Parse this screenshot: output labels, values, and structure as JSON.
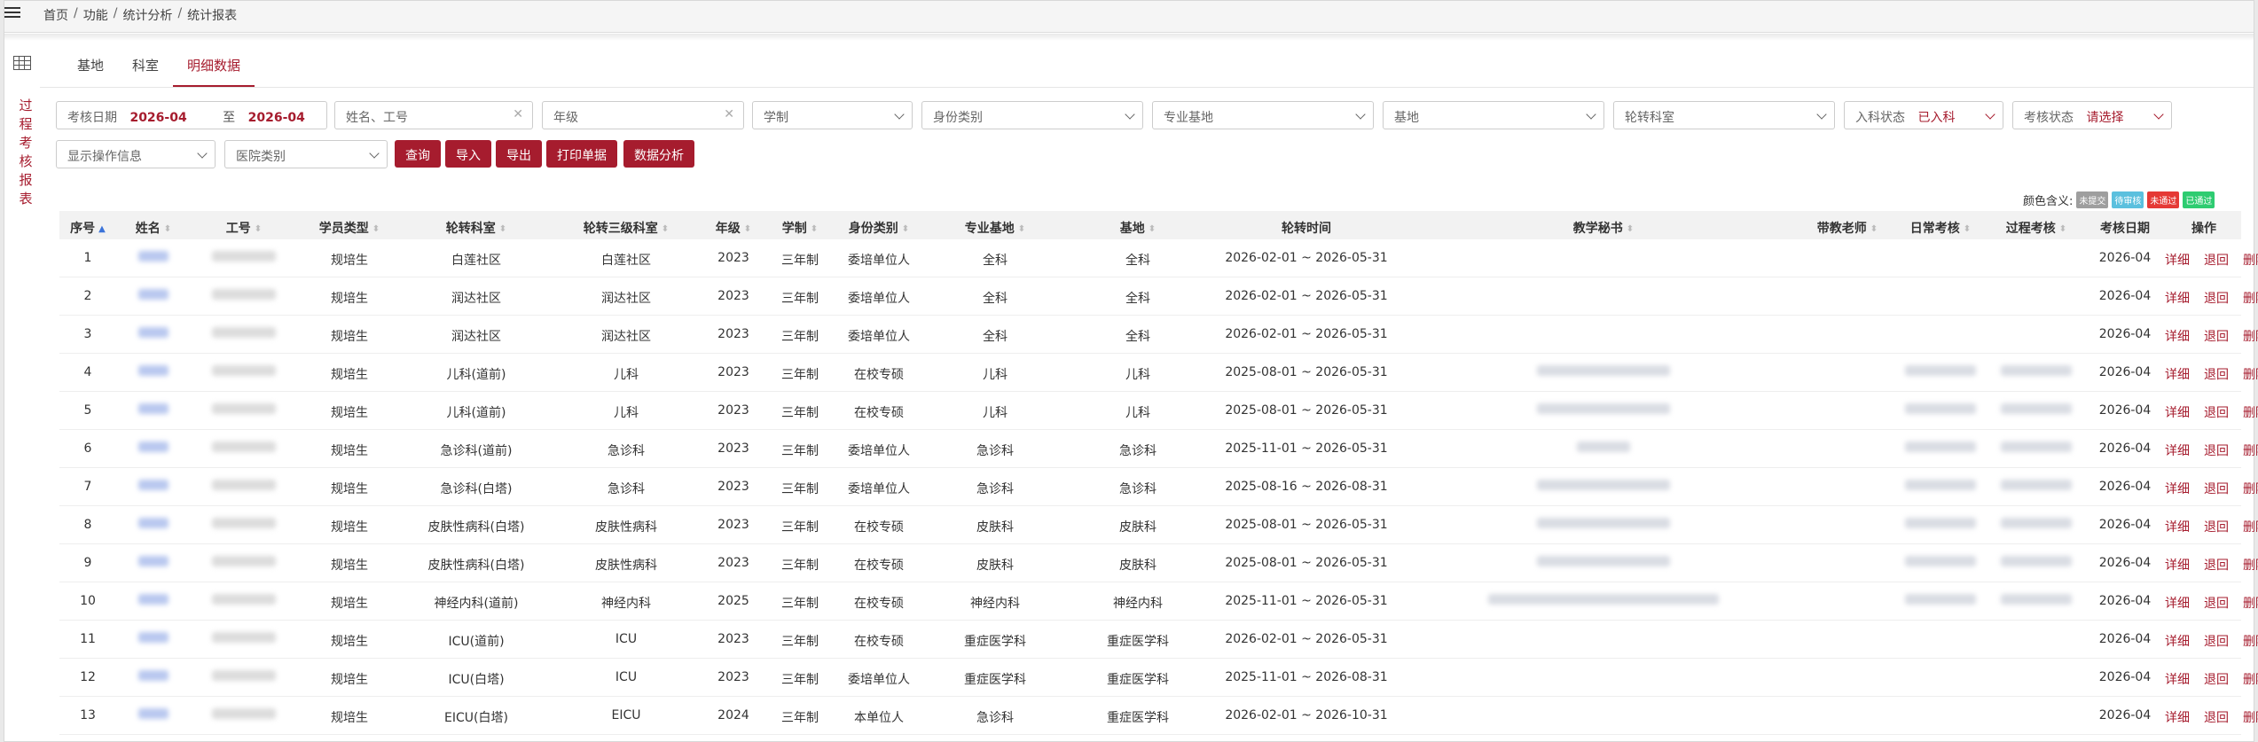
{
  "breadcrumb": [
    "首页",
    "功能",
    "统计分析",
    "统计报表"
  ],
  "side_menu_label": "过程考核报表",
  "tabs": [
    {
      "label": "基地",
      "active": false
    },
    {
      "label": "科室",
      "active": false
    },
    {
      "label": "明细数据",
      "active": true
    }
  ],
  "filters": {
    "date_label": "考核日期",
    "date_from": "2026-04",
    "date_to_sep": "至",
    "date_to": "2026-04",
    "name_placeholder": "姓名、工号",
    "grade_placeholder": "年级",
    "system_placeholder": "学制",
    "identity_placeholder": "身份类别",
    "specialty_placeholder": "专业基地",
    "base_placeholder": "基地",
    "rotation_dept_placeholder": "轮转科室",
    "enroll_label": "入科状态",
    "enroll_value": "已入科",
    "assess_label": "考核状态",
    "assess_value": "请选择",
    "show_ops_placeholder": "显示操作信息",
    "hospital_type_placeholder": "医院类别"
  },
  "buttons": {
    "query": "查询",
    "import": "导入",
    "export": "导出",
    "print": "打印单据",
    "analysis": "数据分析"
  },
  "legend": {
    "label": "颜色含义:",
    "items": [
      {
        "text": "未提交",
        "color": "#9e9e9e"
      },
      {
        "text": "待审核",
        "color": "#5bc0de"
      },
      {
        "text": "未通过",
        "color": "#e53935"
      },
      {
        "text": "已通过",
        "color": "#2ecc71"
      }
    ]
  },
  "columns": [
    "序号",
    "姓名",
    "工号",
    "学员类型",
    "轮转科室",
    "轮转三级科室",
    "年级",
    "学制",
    "身份类别",
    "专业基地",
    "基地",
    "轮转时间",
    "教学秘书",
    "带教老师",
    "日常考核",
    "过程考核",
    "考核日期",
    "操作"
  ],
  "actions": [
    "详细",
    "退回",
    "删除"
  ],
  "rows": [
    {
      "no": "1",
      "type": "规培生",
      "dept": "白莲社区",
      "dept3": "白莲社区",
      "grade": "2023",
      "system": "三年制",
      "identity": "委培单位人",
      "specialty": "全科",
      "base": "全科",
      "period": "2026-02-01 ~ 2026-05-31",
      "date": "2026-04"
    },
    {
      "no": "2",
      "type": "规培生",
      "dept": "润达社区",
      "dept3": "润达社区",
      "grade": "2023",
      "system": "三年制",
      "identity": "委培单位人",
      "specialty": "全科",
      "base": "全科",
      "period": "2026-02-01 ~ 2026-05-31",
      "date": "2026-04"
    },
    {
      "no": "3",
      "type": "规培生",
      "dept": "润达社区",
      "dept3": "润达社区",
      "grade": "2023",
      "system": "三年制",
      "identity": "委培单位人",
      "specialty": "全科",
      "base": "全科",
      "period": "2026-02-01 ~ 2026-05-31",
      "date": "2026-04"
    },
    {
      "no": "4",
      "type": "规培生",
      "dept": "儿科(道前)",
      "dept3": "儿科",
      "grade": "2023",
      "system": "三年制",
      "identity": "在校专硕",
      "specialty": "儿科",
      "base": "儿科",
      "period": "2025-08-01 ~ 2026-05-31",
      "date": "2026-04"
    },
    {
      "no": "5",
      "type": "规培生",
      "dept": "儿科(道前)",
      "dept3": "儿科",
      "grade": "2023",
      "system": "三年制",
      "identity": "在校专硕",
      "specialty": "儿科",
      "base": "儿科",
      "period": "2025-08-01 ~ 2026-05-31",
      "date": "2026-04"
    },
    {
      "no": "6",
      "type": "规培生",
      "dept": "急诊科(道前)",
      "dept3": "急诊科",
      "grade": "2023",
      "system": "三年制",
      "identity": "委培单位人",
      "specialty": "急诊科",
      "base": "急诊科",
      "period": "2025-11-01 ~ 2026-05-31",
      "date": "2026-04"
    },
    {
      "no": "7",
      "type": "规培生",
      "dept": "急诊科(白塔)",
      "dept3": "急诊科",
      "grade": "2023",
      "system": "三年制",
      "identity": "委培单位人",
      "specialty": "急诊科",
      "base": "急诊科",
      "period": "2025-08-16 ~ 2026-08-31",
      "date": "2026-04"
    },
    {
      "no": "8",
      "type": "规培生",
      "dept": "皮肤性病科(白塔)",
      "dept3": "皮肤性病科",
      "grade": "2023",
      "system": "三年制",
      "identity": "在校专硕",
      "specialty": "皮肤科",
      "base": "皮肤科",
      "period": "2025-08-01 ~ 2026-05-31",
      "date": "2026-04"
    },
    {
      "no": "9",
      "type": "规培生",
      "dept": "皮肤性病科(白塔)",
      "dept3": "皮肤性病科",
      "grade": "2023",
      "system": "三年制",
      "identity": "在校专硕",
      "specialty": "皮肤科",
      "base": "皮肤科",
      "period": "2025-08-01 ~ 2026-05-31",
      "date": "2026-04"
    },
    {
      "no": "10",
      "type": "规培生",
      "dept": "神经内科(道前)",
      "dept3": "神经内科",
      "grade": "2025",
      "system": "三年制",
      "identity": "在校专硕",
      "specialty": "神经内科",
      "base": "神经内科",
      "period": "2025-11-01 ~ 2026-05-31",
      "date": "2026-04"
    },
    {
      "no": "11",
      "type": "规培生",
      "dept": "ICU(道前)",
      "dept3": "ICU",
      "grade": "2023",
      "system": "三年制",
      "identity": "在校专硕",
      "specialty": "重症医学科",
      "base": "重症医学科",
      "period": "2026-02-01 ~ 2026-05-31",
      "date": "2026-04"
    },
    {
      "no": "12",
      "type": "规培生",
      "dept": "ICU(白塔)",
      "dept3": "ICU",
      "grade": "2023",
      "system": "三年制",
      "identity": "委培单位人",
      "specialty": "重症医学科",
      "base": "重症医学科",
      "period": "2025-11-01 ~ 2026-08-31",
      "date": "2026-04"
    },
    {
      "no": "13",
      "type": "规培生",
      "dept": "EICU(白塔)",
      "dept3": "EICU",
      "grade": "2024",
      "system": "三年制",
      "identity": "本单位人",
      "specialty": "急诊科",
      "base": "重症医学科",
      "period": "2026-02-01 ~ 2026-10-31",
      "date": "2026-04"
    }
  ]
}
